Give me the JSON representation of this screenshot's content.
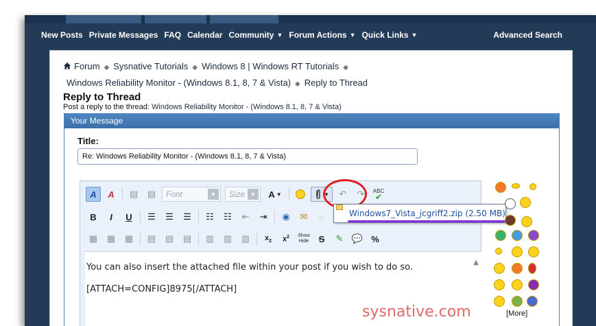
{
  "nav": {
    "items": [
      {
        "label": "New Posts",
        "has_menu": false
      },
      {
        "label": "Private Messages",
        "has_menu": false
      },
      {
        "label": "FAQ",
        "has_menu": false
      },
      {
        "label": "Calendar",
        "has_menu": false
      },
      {
        "label": "Community",
        "has_menu": true
      },
      {
        "label": "Forum Actions",
        "has_menu": true
      },
      {
        "label": "Quick Links",
        "has_menu": true
      }
    ],
    "advanced_search": "Advanced Search"
  },
  "breadcrumb": {
    "items": [
      "Forum",
      "Sysnative Tutorials",
      "Windows 8 | Windows RT Tutorials",
      "Windows Reliability Monitor - (Windows 8.1, 8, 7 & Vista)"
    ],
    "current": "Reply to Thread"
  },
  "page": {
    "title": "Reply to Thread",
    "subtitle_prefix": "Post a reply to the thread:",
    "thread_name": "Windows Reliability Monitor - (Windows 8.1, 8, 7 & Vista)"
  },
  "message": {
    "header": "Your Message",
    "title_label": "Title:",
    "title_value": "Re: Windows Reliability Monitor - (Windows 8.1, 8, 7 & Vista)"
  },
  "toolbar": {
    "font_placeholder": "Font",
    "size_placeholder": "Size",
    "show_hide": [
      "Show",
      "Hide"
    ]
  },
  "editor": {
    "line1": "You can also insert the attached file within your post if you wish to do so.",
    "line2": "[ATTACH=CONFIG]8975[/ATTACH]"
  },
  "attachment": {
    "label": "Windows7_Vista_jcgriff2.zip (2.50 MB)"
  },
  "smilies": {
    "more": "[More]"
  },
  "watermark": "sysnative.com",
  "colors": {
    "frame_bg": "#243b58",
    "header_blue": "#3a6ea8",
    "link": "#1f4f9e",
    "highlight_circle": "#e02020",
    "underline": "#8a2be2"
  }
}
